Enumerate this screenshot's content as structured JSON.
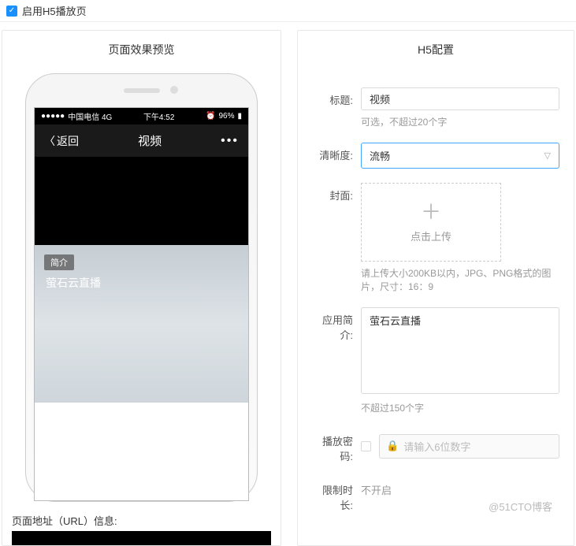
{
  "top": {
    "enable_label": "启用H5播放页"
  },
  "left": {
    "header": "页面效果预览",
    "status": {
      "carrier": "中国电信  4G",
      "time": "下午4:52",
      "battery": "96%"
    },
    "nav": {
      "back": "返回",
      "title": "视频"
    },
    "intro_tag": "简介",
    "intro_text": "萤石云直播",
    "url_label": "页面地址（URL）信息:"
  },
  "right": {
    "header": "H5配置",
    "title_label": "标题:",
    "title_value": "视频",
    "title_hint": "可选，不超过20个字",
    "clarity_label": "清晰度:",
    "clarity_value": "流畅",
    "cover_label": "封面:",
    "upload_text": "点击上传",
    "cover_hint": "请上传大小200KB以内，JPG、PNG格式的图片，尺寸：16：9",
    "intro_label": "应用简介:",
    "intro_value": "萤石云直播",
    "intro_hint": "不超过150个字",
    "password_label": "播放密码:",
    "password_placeholder": "请输入6位数字",
    "limit_label": "限制时长:",
    "limit_value": "不开启"
  },
  "watermark": "@51CTO博客"
}
